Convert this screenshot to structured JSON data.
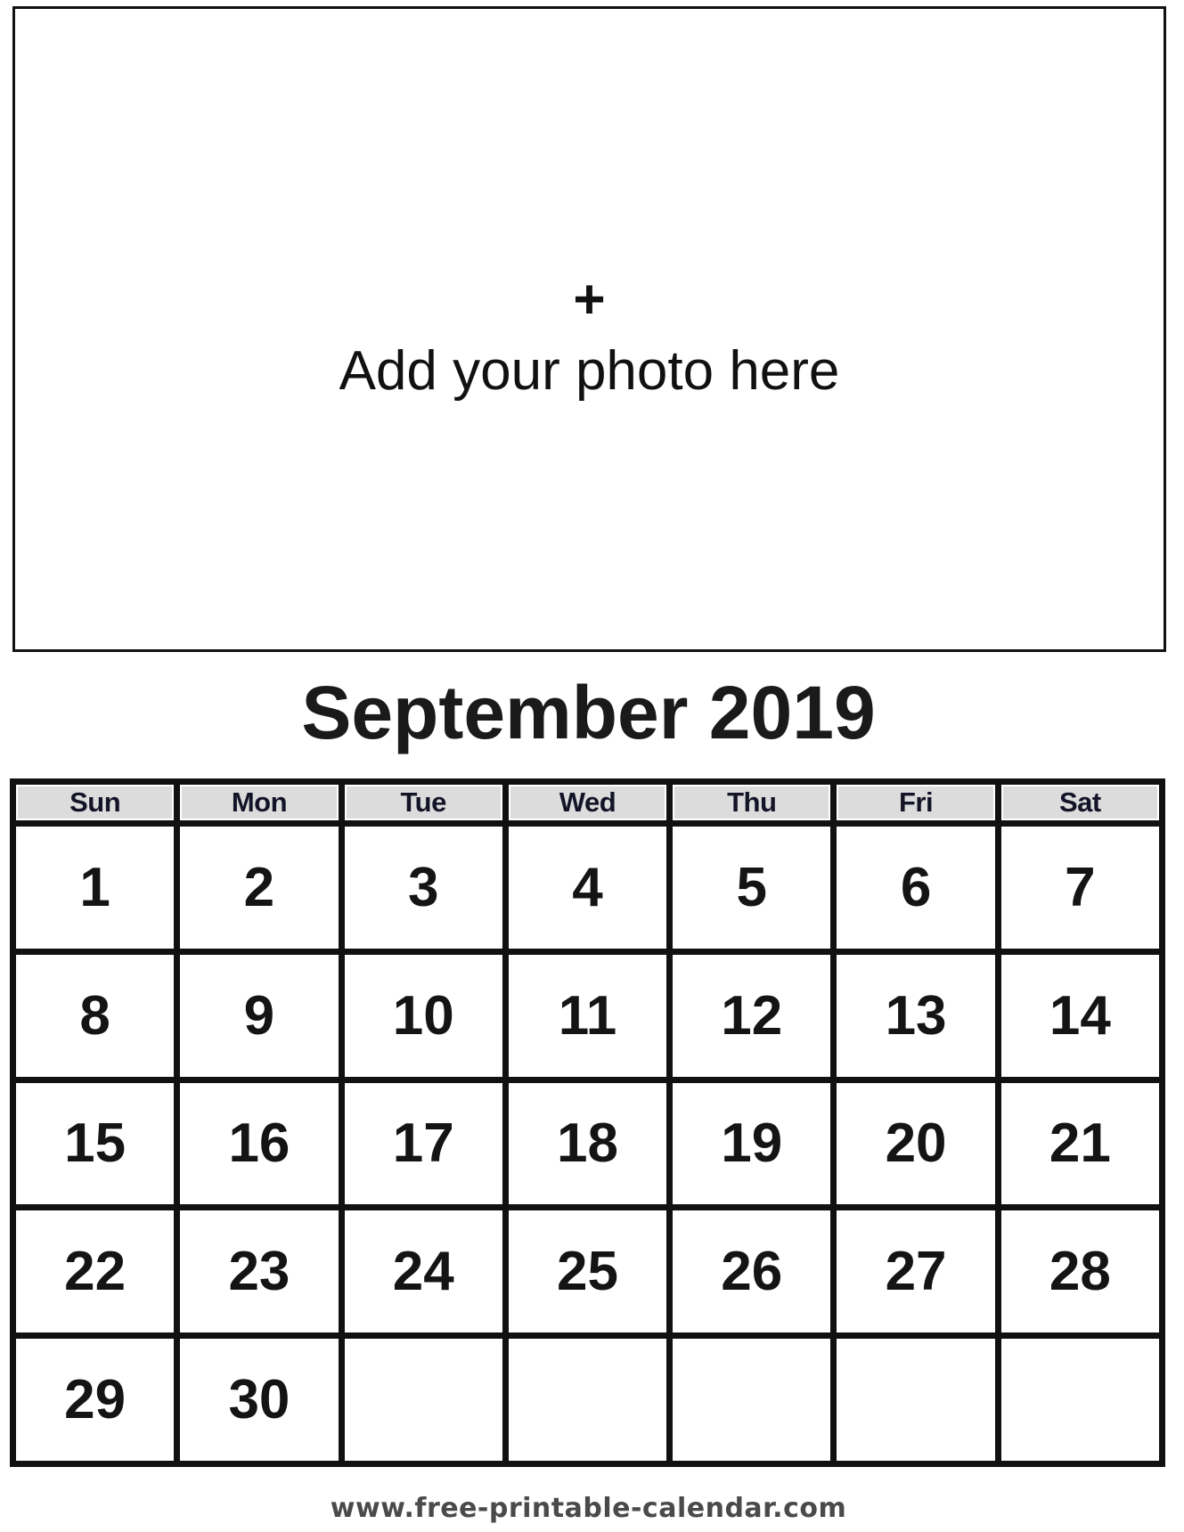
{
  "photo_placeholder": {
    "icon": "plus-icon",
    "icon_glyph": "+",
    "label": "Add your photo here"
  },
  "calendar": {
    "title": "September 2019",
    "month": "September",
    "year": 2019,
    "weekdays": [
      "Sun",
      "Mon",
      "Tue",
      "Wed",
      "Thu",
      "Fri",
      "Sat"
    ],
    "weeks": [
      [
        "1",
        "2",
        "3",
        "4",
        "5",
        "6",
        "7"
      ],
      [
        "8",
        "9",
        "10",
        "11",
        "12",
        "13",
        "14"
      ],
      [
        "15",
        "16",
        "17",
        "18",
        "19",
        "20",
        "21"
      ],
      [
        "22",
        "23",
        "24",
        "25",
        "26",
        "27",
        "28"
      ],
      [
        "29",
        "30",
        "",
        "",
        "",
        "",
        ""
      ]
    ],
    "colors": {
      "grid_line": "#111111",
      "header_fill": "#dcdcdc",
      "cell_fill": "#ffffff"
    }
  },
  "footer": {
    "url_text": "www.free-printable-calendar.com"
  }
}
